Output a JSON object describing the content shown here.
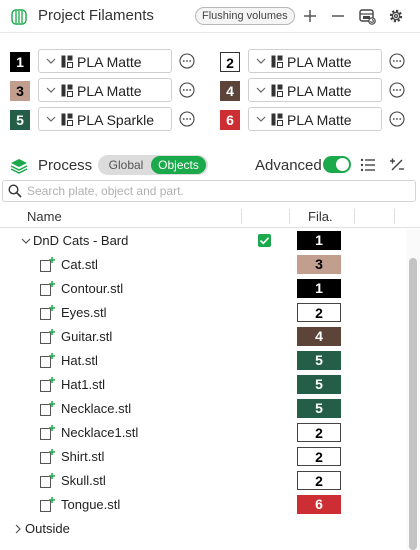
{
  "header": {
    "title": "Project Filaments",
    "flushing_label": "Flushing volumes",
    "icons": [
      "filament-spool-icon",
      "add-icon",
      "remove-icon",
      "sync-printer-icon",
      "gear-icon"
    ]
  },
  "filaments": [
    {
      "num": "1",
      "name": "PLA Matte",
      "color": "#000000",
      "text_color": "#ffffff",
      "outlined": false
    },
    {
      "num": "2",
      "name": "PLA Matte",
      "color": "#ffffff",
      "text_color": "#000000",
      "outlined": true
    },
    {
      "num": "3",
      "name": "PLA Matte",
      "color": "#c19e8e",
      "text_color": "#000000",
      "outlined": false
    },
    {
      "num": "4",
      "name": "PLA Matte",
      "color": "#5c4538",
      "text_color": "#ffffff",
      "outlined": false
    },
    {
      "num": "5",
      "name": "PLA Sparkle",
      "color": "#245e48",
      "text_color": "#ffffff",
      "outlined": false
    },
    {
      "num": "6",
      "name": "PLA Matte",
      "color": "#cc2e33",
      "text_color": "#ffffff",
      "outlined": false
    }
  ],
  "process": {
    "title": "Process",
    "seg_global": "Global",
    "seg_objects": "Objects",
    "selected": "Objects",
    "advanced_label": "Advanced",
    "advanced_on": true,
    "accent_color": "#1aa94b"
  },
  "search": {
    "placeholder": "Search plate, object and part.",
    "value": ""
  },
  "table": {
    "col_name": "Name",
    "col_fila": "Fila."
  },
  "tree": {
    "root": {
      "label": "DnD Cats - Bard",
      "expanded": true,
      "checked": true,
      "fila": "1"
    },
    "parts": [
      {
        "name": "Cat.stl",
        "fila": "3"
      },
      {
        "name": "Contour.stl",
        "fila": "1"
      },
      {
        "name": "Eyes.stl",
        "fila": "2"
      },
      {
        "name": "Guitar.stl",
        "fila": "4"
      },
      {
        "name": "Hat.stl",
        "fila": "5"
      },
      {
        "name": "Hat1.stl",
        "fila": "5"
      },
      {
        "name": "Necklace.stl",
        "fila": "5"
      },
      {
        "name": "Necklace1.stl",
        "fila": "2"
      },
      {
        "name": "Shirt.stl",
        "fila": "2"
      },
      {
        "name": "Skull.stl",
        "fila": "2"
      },
      {
        "name": "Tongue.stl",
        "fila": "6"
      }
    ],
    "collapsed": {
      "label": "Outside",
      "expanded": false
    }
  }
}
